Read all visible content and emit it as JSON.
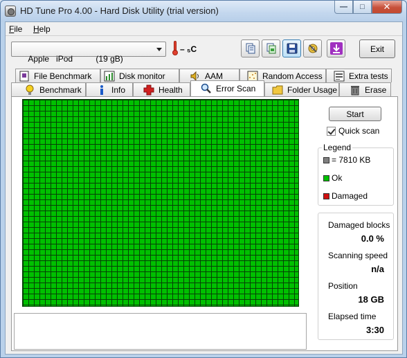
{
  "window": {
    "title": "HD Tune Pro 4.00 - Hard Disk Utility (trial version)",
    "controls": {
      "minimize": "—",
      "maximize": "□",
      "close": "✕"
    }
  },
  "menu": {
    "file": {
      "accel": "F",
      "rest": "ile"
    },
    "help": {
      "accel": "H",
      "rest": "elp"
    }
  },
  "toolbar": {
    "drive_selected": "Apple   iPod          (19 gB)",
    "temperature": "– ₅C",
    "buttons": [
      "copy-info-icon",
      "copy-screenshot-icon",
      "save-icon",
      "options-icon",
      "download-icon"
    ],
    "exit_label": "Exit"
  },
  "tabs": {
    "row1": [
      {
        "label": "File Benchmark",
        "icon": "file-benchmark-icon"
      },
      {
        "label": "Disk monitor",
        "icon": "disk-monitor-icon"
      },
      {
        "label": "AAM",
        "icon": "speaker-icon"
      },
      {
        "label": "Random Access",
        "icon": "random-access-icon"
      },
      {
        "label": "Extra tests",
        "icon": "extra-tests-icon"
      }
    ],
    "row2": [
      {
        "label": "Benchmark",
        "icon": "benchmark-bulb-icon"
      },
      {
        "label": "Info",
        "icon": "info-icon"
      },
      {
        "label": "Health",
        "icon": "health-cross-icon"
      },
      {
        "label": "Error Scan",
        "icon": "magnifier-icon"
      },
      {
        "label": "Folder Usage",
        "icon": "folder-icon"
      },
      {
        "label": "Erase",
        "icon": "trash-icon"
      }
    ],
    "selected": "Error Scan"
  },
  "scan": {
    "start_label": "Start",
    "quick_scan_label": "Quick scan",
    "quick_scan_checked": true,
    "block_color": "#00c000"
  },
  "legend": {
    "title": "Legend",
    "block_size": "= 7810 KB",
    "ok_label": "Ok",
    "damaged_label": "Damaged",
    "colors": {
      "block": "#808080",
      "ok": "#00c000",
      "damaged": "#d01010"
    }
  },
  "stats": {
    "damaged_blocks_label": "Damaged blocks",
    "damaged_blocks_value": "0.0 %",
    "scanning_speed_label": "Scanning speed",
    "scanning_speed_value": "n/a",
    "position_label": "Position",
    "position_value": "18 GB",
    "elapsed_time_label": "Elapsed time",
    "elapsed_time_value": "3:30"
  }
}
